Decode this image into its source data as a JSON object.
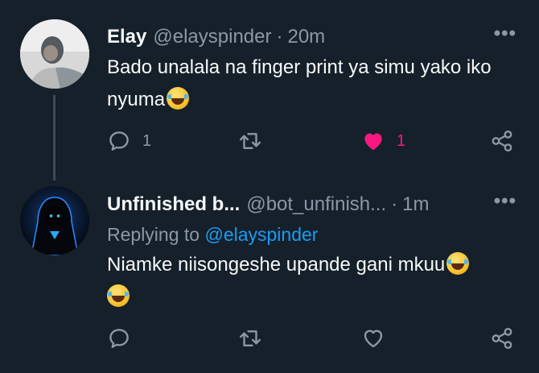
{
  "tweets": [
    {
      "author_name": "Elay",
      "handle": "@elayspinder",
      "separator": "·",
      "time": "20m",
      "more_label": "•••",
      "text": "Bado unalala na finger print ya simu yako iko nyuma",
      "trailing_emoji": "face-with-tears-of-joy",
      "reply_count": "1",
      "like_count": "1",
      "liked": true
    },
    {
      "author_name": "Unfinished b...",
      "handle": "@bot_unfinish...",
      "separator": "·",
      "time": "1m",
      "more_label": "•••",
      "replying_prefix": "Replying to",
      "replying_to": "@elayspinder",
      "text": "Niamke niisongeshe upande gani mkuu",
      "trailing_emoji": "face-with-tears-of-joy",
      "liked": false
    }
  ],
  "colors": {
    "background": "#15202b",
    "text": "#f7f9f9",
    "muted": "#8b98a5",
    "link": "#1d9bf0",
    "like": "#f91880",
    "thread_line": "#3d4b57"
  }
}
